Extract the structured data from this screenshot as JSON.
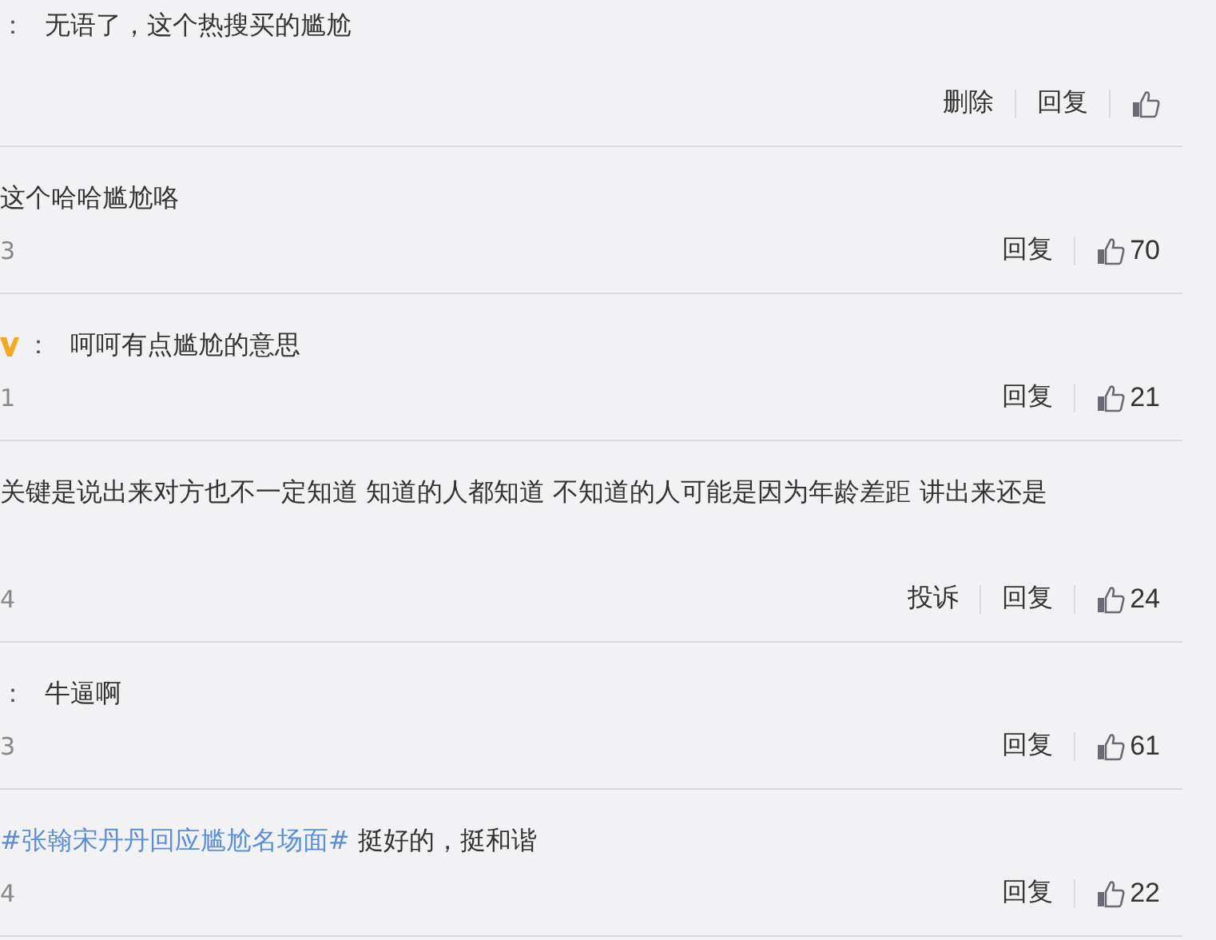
{
  "comments": [
    {
      "colon": "：",
      "verified": false,
      "text": "无语了，这个热搜买的尴尬",
      "actions": [
        "删除",
        "回复"
      ]
    },
    {
      "verified": false,
      "text": "这个哈哈尴尬咯",
      "time": "3",
      "actions": [
        "回复"
      ],
      "likes": "70"
    },
    {
      "colon": "：",
      "verified": true,
      "text": "呵呵有点尴尬的意思",
      "time": "1",
      "actions": [
        "回复"
      ],
      "likes": "21"
    },
    {
      "verified": false,
      "text": "关键是说出来对方也不一定知道 知道的人都知道 不知道的人可能是因为年龄差距 讲出来还是",
      "time": "4",
      "actions": [
        "投诉",
        "回复"
      ],
      "likes": "24"
    },
    {
      "colon": "：",
      "verified": false,
      "text": "牛逼啊",
      "time": "3",
      "actions": [
        "回复"
      ],
      "likes": "61"
    },
    {
      "verified": false,
      "topic": "#张翰宋丹丹回应尴尬名场面#",
      "text": "挺好的，挺和谐",
      "time": "4",
      "actions": [
        "回复"
      ],
      "likes": "22"
    }
  ]
}
